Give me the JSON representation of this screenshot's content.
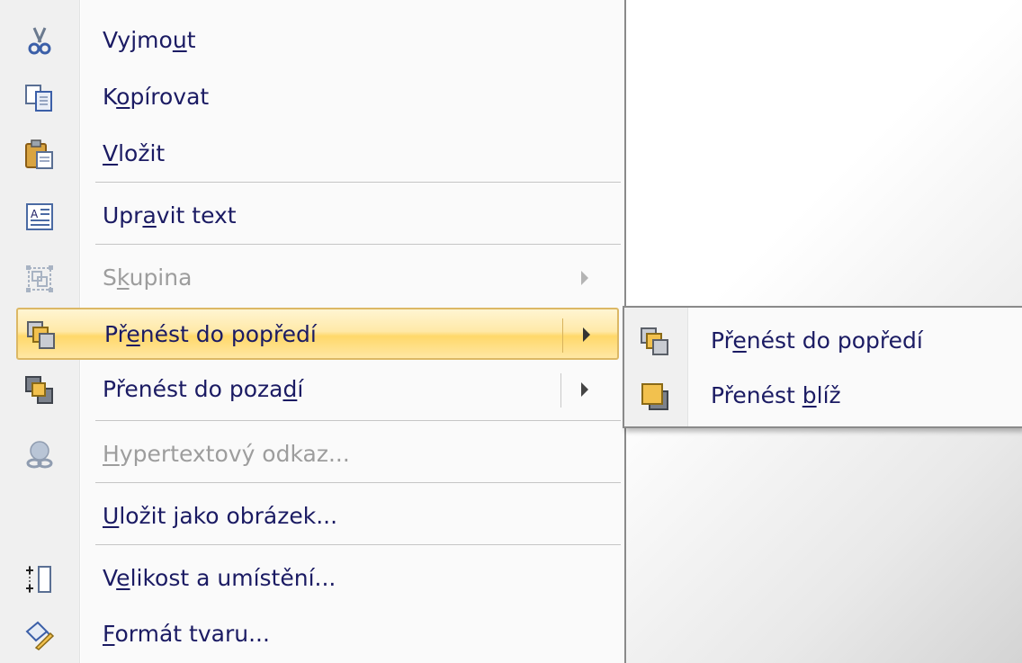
{
  "context_menu": {
    "items": [
      {
        "pre": "Vyjmo",
        "key": "u",
        "post": "t",
        "icon": "scissors-icon"
      },
      {
        "pre": "K",
        "key": "o",
        "post": "pírovat",
        "icon": "copy-icon"
      },
      {
        "pre": "",
        "key": "V",
        "post": "ložit",
        "icon": "paste-icon"
      },
      {
        "pre": "Upr",
        "key": "a",
        "post": "vit text",
        "icon": "edit-text-icon"
      },
      {
        "pre": "S",
        "key": "k",
        "post": "upina",
        "icon": "group-icon",
        "disabled": true
      },
      {
        "pre": "Př",
        "key": "e",
        "post": "nést do popředí",
        "icon": "bring-to-front-icon"
      },
      {
        "pre": "Přenést do poza",
        "key": "d",
        "post": "í",
        "icon": "send-to-back-icon"
      },
      {
        "pre": "",
        "key": "H",
        "post": "ypertextový odkaz...",
        "icon": "hyperlink-icon",
        "disabled": true
      },
      {
        "pre": "",
        "key": "U",
        "post": "ložit jako obrázek..."
      },
      {
        "pre": "V",
        "key": "e",
        "post": "likost a umístění...",
        "icon": "size-position-icon"
      },
      {
        "pre": "",
        "key": "F",
        "post": "ormát tvaru...",
        "icon": "format-shape-icon"
      }
    ]
  },
  "submenu": {
    "items": [
      {
        "pre": "Př",
        "key": "e",
        "post": "nést do popředí",
        "icon": "bring-to-front-icon"
      },
      {
        "pre": "Přenést ",
        "key": "b",
        "post": "líž",
        "icon": "bring-forward-icon"
      }
    ]
  }
}
